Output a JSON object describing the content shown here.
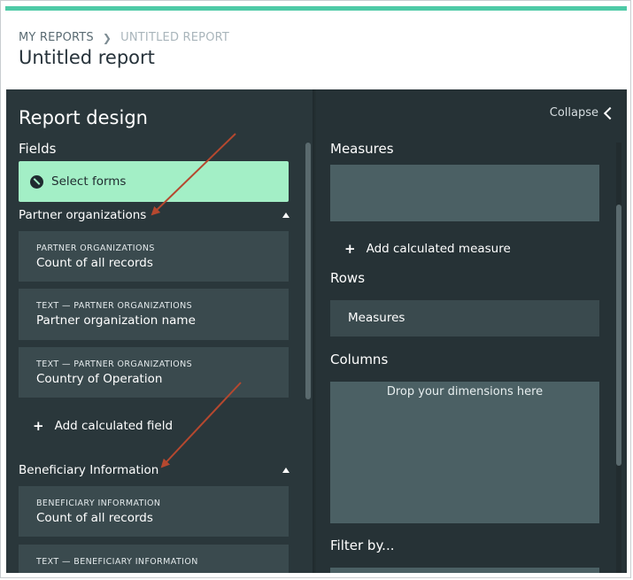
{
  "breadcrumb": {
    "root": "MY REPORTS",
    "current": "UNTITLED REPORT"
  },
  "page": {
    "title": "Untitled report"
  },
  "left": {
    "title": "Report design",
    "fields_label": "Fields",
    "select_forms": "Select forms",
    "groups": [
      {
        "name": "Partner organizations",
        "cards": [
          {
            "category": "PARTNER ORGANIZATIONS",
            "name": "Count of all records"
          },
          {
            "category": "TEXT — PARTNER ORGANIZATIONS",
            "name": "Partner organization name"
          },
          {
            "category": "TEXT — PARTNER ORGANIZATIONS",
            "name": "Country of Operation"
          }
        ],
        "add_label": "Add calculated field"
      },
      {
        "name": "Beneficiary Information",
        "cards": [
          {
            "category": "BENEFICIARY INFORMATION",
            "name": "Count of all records"
          },
          {
            "category": "TEXT — BENEFICIARY INFORMATION",
            "name": ""
          }
        ]
      }
    ]
  },
  "right": {
    "collapse": "Collapse",
    "measures_label": "Measures",
    "add_measure": "Add calculated measure",
    "rows_label": "Rows",
    "rows_chip": "Measures",
    "columns_label": "Columns",
    "columns_hint": "Drop your dimensions here",
    "filter_label": "Filter by..."
  },
  "colors": {
    "accent": "#4ecaa6",
    "select_forms_bg": "#a3efc6",
    "panel_bg": "#263236",
    "card_bg": "#3a4a4e",
    "arrow": "#b5482f"
  }
}
